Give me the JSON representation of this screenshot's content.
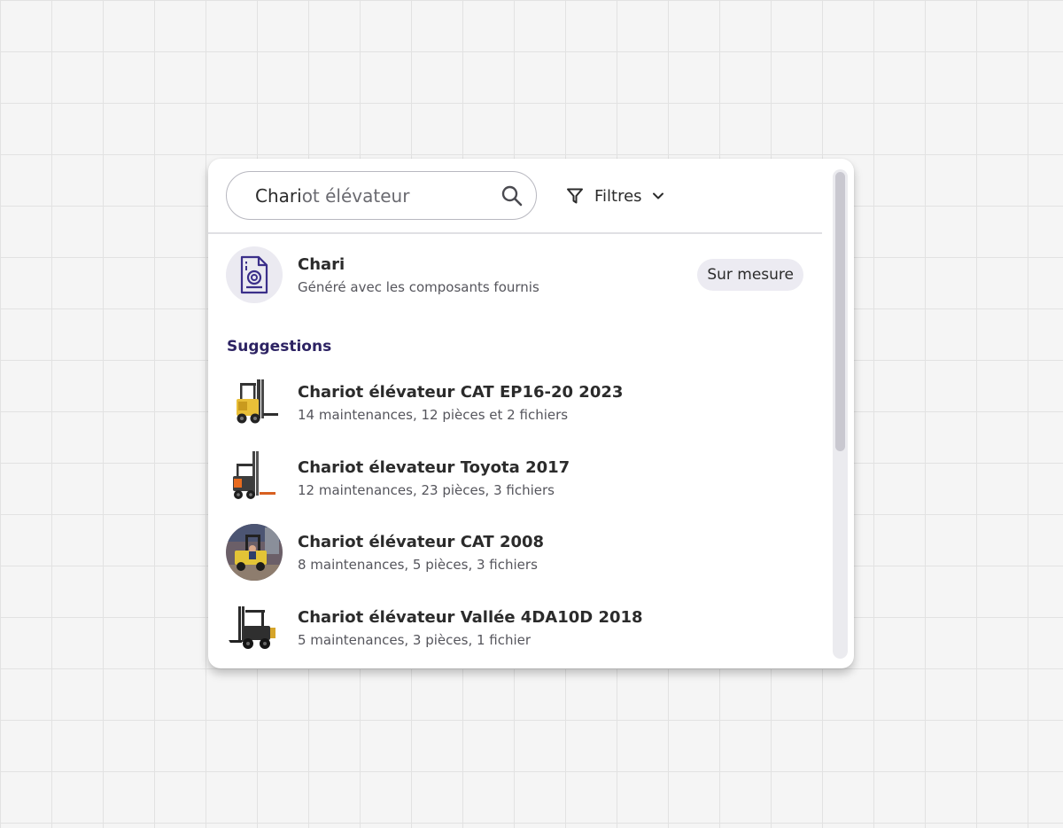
{
  "search": {
    "typed": "Chari",
    "completion": "ot élévateur"
  },
  "filters": {
    "label": "Filtres"
  },
  "custom": {
    "title": "Chari",
    "subtitle": "Généré avec les composants fournis",
    "badge": "Sur mesure"
  },
  "suggestions": {
    "heading": "Suggestions",
    "items": [
      {
        "title": "Chariot élévateur CAT EP16-20 2023",
        "subtitle": "14 maintenances, 12 pièces et 2 fichiers"
      },
      {
        "title": "Chariot élevateur Toyota 2017",
        "subtitle": "12 maintenances, 23 pièces, 3 fichiers"
      },
      {
        "title": "Chariot élévateur CAT 2008",
        "subtitle": "8 maintenances, 5 pièces, 3 fichiers"
      },
      {
        "title": "Chariot élévateur Vallée 4DA10D 2018",
        "subtitle": "5 maintenances, 3 pièces, 1 fichier"
      }
    ]
  },
  "colors": {
    "accent": "#2d2363",
    "doc_icon": "#3b2f8a",
    "badge_bg": "#ecebf2"
  },
  "icons": {
    "search": "search-icon",
    "filter": "funnel-icon",
    "dropdown": "chevron-down-icon",
    "document": "document-icon"
  }
}
